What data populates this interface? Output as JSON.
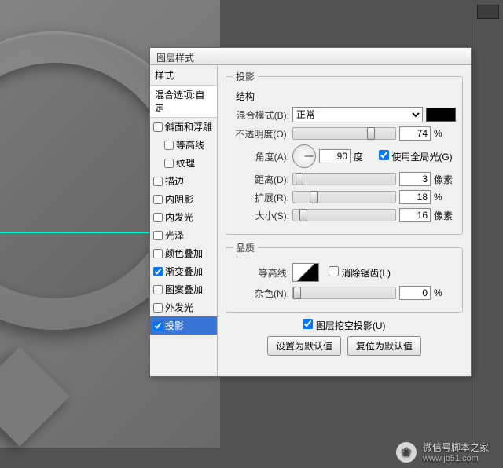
{
  "dialog": {
    "title": "图层样式",
    "styles_header": "样式",
    "blend_options": "混合选项:自定",
    "items": [
      {
        "label": "斜面和浮雕",
        "checked": false,
        "indent": false
      },
      {
        "label": "等高线",
        "checked": false,
        "indent": true
      },
      {
        "label": "纹理",
        "checked": false,
        "indent": true
      },
      {
        "label": "描边",
        "checked": false,
        "indent": false
      },
      {
        "label": "内阴影",
        "checked": false,
        "indent": false
      },
      {
        "label": "内发光",
        "checked": false,
        "indent": false
      },
      {
        "label": "光泽",
        "checked": false,
        "indent": false
      },
      {
        "label": "颜色叠加",
        "checked": false,
        "indent": false
      },
      {
        "label": "渐变叠加",
        "checked": true,
        "indent": false
      },
      {
        "label": "图案叠加",
        "checked": false,
        "indent": false
      },
      {
        "label": "外发光",
        "checked": false,
        "indent": false
      },
      {
        "label": "投影",
        "checked": true,
        "indent": false,
        "active": true
      }
    ]
  },
  "shadow": {
    "section": "投影",
    "structure": "结构",
    "blend_mode_label": "混合模式(B):",
    "blend_mode_value": "正常",
    "opacity_label": "不透明度(O):",
    "opacity_value": "74",
    "opacity_unit": "%",
    "angle_label": "角度(A):",
    "angle_value": "90",
    "angle_unit": "度",
    "global_light": "使用全局光(G)",
    "global_light_checked": true,
    "distance_label": "距离(D):",
    "distance_value": "3",
    "distance_unit": "像素",
    "spread_label": "扩展(R):",
    "spread_value": "18",
    "spread_unit": "%",
    "size_label": "大小(S):",
    "size_value": "16",
    "size_unit": "像素",
    "quality": "品质",
    "contour_label": "等高线:",
    "antialias": "消除锯齿(L)",
    "noise_label": "杂色(N):",
    "noise_value": "0",
    "noise_unit": "%",
    "knockout": "图层挖空投影(U)",
    "knockout_checked": true,
    "btn_default": "设置为默认值",
    "btn_reset": "复位为默认值"
  },
  "watermark": {
    "text": "微信号脚本之家",
    "url": "www.jb51.com"
  }
}
